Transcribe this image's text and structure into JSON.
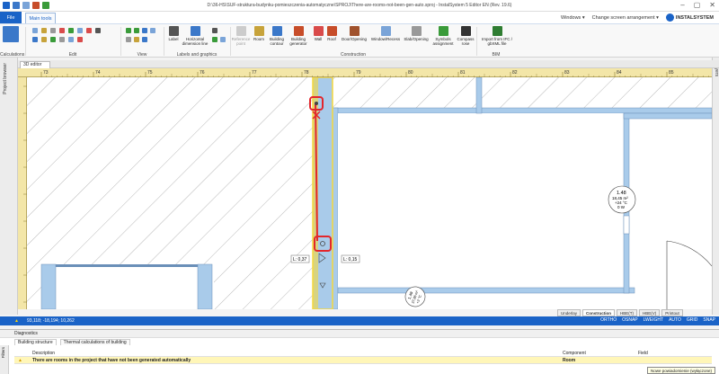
{
  "window": {
    "title": "D:\\36-HS\\SUF-struktura-budynku-pomieszczenia-automatyczne\\SPROJ\\There-are-rooms-not-been-gen-auto.sproj - InstalSystem 5 Editor EN (Rev. 19.6)",
    "controls": [
      "–",
      "▢",
      "✕"
    ]
  },
  "tabs": {
    "file": "File",
    "main": "Main tools"
  },
  "topright": {
    "windows": "Windows ▾",
    "change_screen": "Change screen arrangement ▾",
    "brand": "INSTALSYSTEM"
  },
  "ribbon": {
    "calculations_label": "Calculations",
    "edit_label": "Edit",
    "view_label": "View",
    "labels_label": "Labels and graphics",
    "construction_label": "Construction",
    "bim_label": "BIM",
    "label_btn": "Label",
    "horiz_btn": "Horizontal dimension line",
    "ref_btn": "Reference point",
    "room_btn": "Room",
    "contour_btn": "Building contour",
    "generator_btn": "Building generator",
    "wall_btn": "Wall",
    "roof_btn": "Roof",
    "door_btn": "Door/Opening",
    "window_btn": "Window/Recess",
    "slab_btn": "Slab/Opening",
    "symbols_btn": "Symbols assignment",
    "compass_btn": "Compass rose",
    "import_btn": "Import from IFC / gbXML file"
  },
  "doc": {
    "tab": "3D editor"
  },
  "side": {
    "left": "Project browser",
    "right": "Layers"
  },
  "ruler": {
    "top": [
      "73",
      "74",
      "75",
      "76",
      "77",
      "78",
      "79",
      "80",
      "81",
      "82",
      "83",
      "84",
      "85"
    ]
  },
  "canvas": {
    "dim_left": "L: 0,37",
    "dim_right": "L: 0,15",
    "room": {
      "num": "1.48",
      "area": "18,45 m²",
      "temp": "+24 °C",
      "type": "0 W"
    },
    "room_small": {
      "num": "1.49",
      "area": "37,86 m²",
      "temp": "+2 °C"
    }
  },
  "status": {
    "coords": "93,118; -18,194; 10,262",
    "right": [
      "ORTHO",
      "OSNAP",
      "LWEIGHT",
      "AUTO",
      "GRID",
      "SNAP"
    ]
  },
  "view_tabs": [
    "Underlay",
    "Construction",
    "HBE(T)",
    "HBE(V)",
    "Printout"
  ],
  "diagnostics": {
    "title": "Diagnostics",
    "tab1": "Building structure",
    "tab2": "Thermal calculations of building",
    "col_desc": "Description",
    "col_comp": "Component",
    "col_field": "Field",
    "row_desc": "There are rooms in the project that have not been generated automatically",
    "row_comp": "Room",
    "filters": "Filters",
    "tooltip": "Nowe powiadomienie (wyłączone)"
  },
  "colors": {
    "accent": "#1a63c7",
    "highlight": "#e3262c",
    "wall": "#a9cbea",
    "selected": "#f6d83b"
  }
}
